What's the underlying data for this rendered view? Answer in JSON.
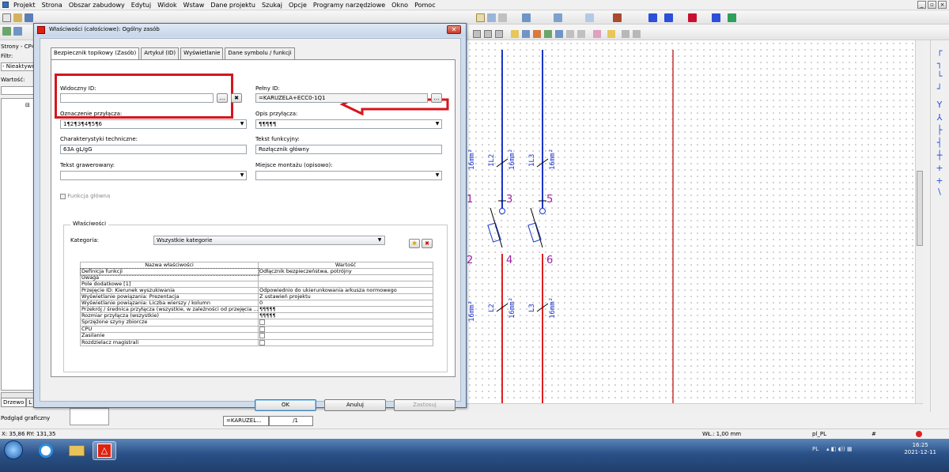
{
  "menubar": {
    "items": [
      "Projekt",
      "Strona",
      "Obszar zabudowy",
      "Edytuj",
      "Widok",
      "Wstaw",
      "Dane projektu",
      "Szukaj",
      "Opcje",
      "Programy narzędziowe",
      "Okno",
      "Pomoc"
    ]
  },
  "left_panel": {
    "title": "Strony - CP4",
    "filter_label": "Filtr:",
    "filter_value": "- Nieaktywny -",
    "value_label": "Wartość:",
    "tab_tree": "Drzewo",
    "tab_list": "L",
    "preview_label": "Podgląd graficzny"
  },
  "canvas": {
    "labels_blue": [
      "16mm²",
      "1L2",
      "16mm²",
      "1L3",
      "16mm²",
      "16mm²",
      "L2",
      "16mm²",
      "L3",
      "16mm²"
    ],
    "labels_purple": [
      "1",
      "3",
      "5",
      "2",
      "4",
      "6"
    ]
  },
  "page_tabs": {
    "tab1": "=KARUZEL...",
    "tab2": "/1"
  },
  "statusbar": {
    "coords": "X: 35,86  RY: 131,35",
    "grid": "WŁ.: 1,00 mm",
    "locale": "pl_PL",
    "hash": "#"
  },
  "taskbar": {
    "tray_lang": "PL",
    "time": "16:25",
    "date": "2021-12-11"
  },
  "dialog": {
    "title": "Właściwości (całościowe): Ogólny zasób",
    "tabs": [
      "Bezpiecznik topikowy (Zasób)",
      "Artykuł (ID)",
      "Wyświetlanie",
      "Dane symbolu / funkcji"
    ],
    "visible_id_label": "Widoczny ID:",
    "visible_id_value": "",
    "full_id_label": "Pełny ID:",
    "full_id_value": "=KARUZELA+ECC0-1Q1",
    "connection_label": "Oznaczenie przyłącza:",
    "connection_value": "1¶2¶3¶4¶5¶6",
    "connection_desc_label": "Opis przyłącza:",
    "connection_desc_value": "¶¶¶¶¶",
    "tech_label": "Charakterystyki techniczne:",
    "tech_value": "63A gL/gG",
    "func_text_label": "Tekst funkcyjny:",
    "func_text_value": "Rozłącznik główny",
    "engrave_label": "Tekst grawerowany:",
    "engrave_value": "",
    "mount_label": "Miejsce montażu (opisowo):",
    "mount_value": "",
    "main_function_label": "Funkcja główna",
    "props_group_label": "Właściwości",
    "category_label": "Kategoria:",
    "category_value": "Wszystkie kategorie",
    "table_headers": [
      "Nazwa właściwości",
      "Wartość"
    ],
    "table_rows": [
      {
        "name": "Definicja funkcji",
        "value": "Odłącznik bezpieczeństwa, potrójny"
      },
      {
        "name": "Uwaga",
        "value": ""
      },
      {
        "name": "Pole dodatkowe [1]",
        "value": ""
      },
      {
        "name": "Przejęcie ID: Kierunek wyszukiwania",
        "value": "Odpowiednio do ukierunkowania arkusza normowego"
      },
      {
        "name": "Wyświetlanie powiązania: Prezentacja",
        "value": "Z ustawień projektu"
      },
      {
        "name": "Wyświetlanie powiązania: Liczba wierszy / kolumn",
        "value": "0"
      },
      {
        "name": "Przekrój / średnica przyłącza (wszystkie, w zależności od przejęcia ...",
        "value": "¶¶¶¶¶"
      },
      {
        "name": "Rozmiar przyłącza (wszystkie)",
        "value": "¶¶¶¶¶"
      },
      {
        "name": "Sprzężone szyny zbiorcze",
        "value": "checkbox"
      },
      {
        "name": "CPU",
        "value": "checkbox"
      },
      {
        "name": "Zasilanie",
        "value": "checkbox"
      },
      {
        "name": "Rozdzielacz magistrali",
        "value": "checkbox"
      }
    ],
    "ok_label": "OK",
    "cancel_label": "Anuluj",
    "apply_label": "Zastosuj"
  },
  "colors": {
    "wire_blue": "#1a35c8",
    "wire_red": "#e02020",
    "highlight_red": "#d5161e",
    "label_purple": "#a020a0"
  }
}
